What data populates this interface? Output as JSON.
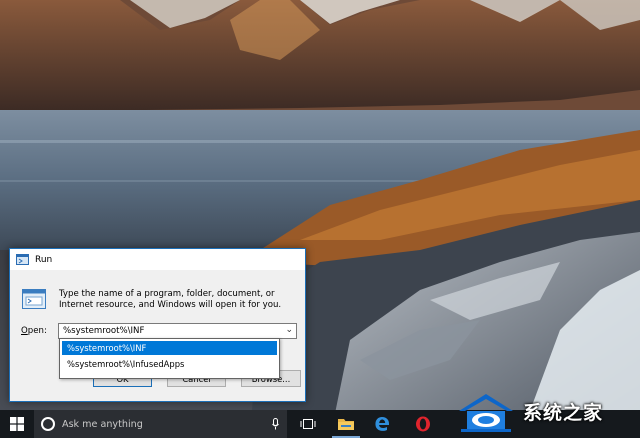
{
  "run_dialog": {
    "title": "Run",
    "description": "Type the name of a program, folder, document, or Internet resource, and Windows will open it for you.",
    "open_label": "Open:",
    "input_value": "%systemroot%\\INF",
    "autocomplete": [
      "%systemroot%\\INF",
      "%systemroot%\\InfusedApps"
    ],
    "buttons": {
      "ok": "OK",
      "cancel": "Cancel",
      "browse": "Browse..."
    }
  },
  "taskbar": {
    "search_placeholder": "Ask me anything",
    "accent": "#0078d7"
  },
  "watermark": {
    "text": "系统之家"
  },
  "icons": [
    "windows-logo-icon",
    "cortana-ring-icon",
    "microphone-icon",
    "task-view-icon",
    "file-explorer-icon",
    "edge-icon",
    "opera-icon"
  ]
}
